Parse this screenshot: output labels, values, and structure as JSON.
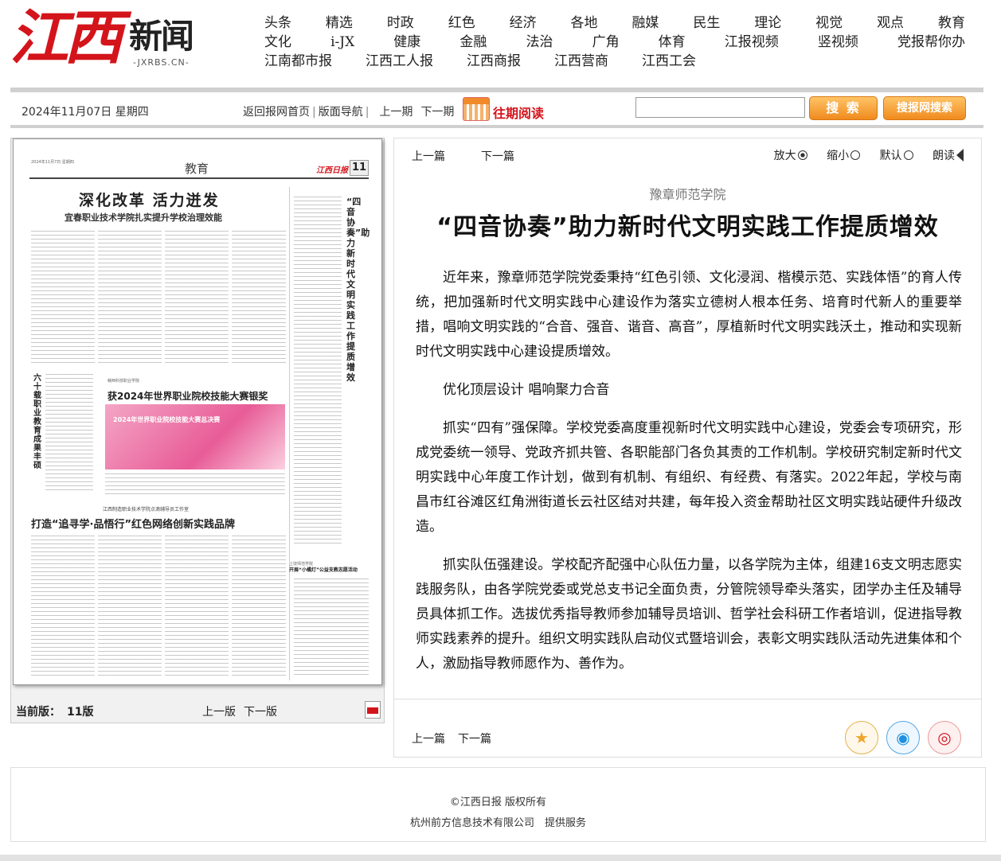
{
  "logo": {
    "calligraphy": "江西",
    "name": "新闻",
    "sub": "-JXRBS.CN-"
  },
  "nav": {
    "row1": [
      "头条",
      "精选",
      "时政",
      "红色",
      "经济",
      "各地",
      "融媒",
      "民生",
      "理论",
      "视觉",
      "观点",
      "教育"
    ],
    "row2": [
      "文化",
      "i-JX",
      "健康",
      "金融",
      "法治",
      "广角",
      "体育",
      "江报视频",
      "竖视频",
      "党报帮你办"
    ],
    "row3": [
      "江南都市报",
      "江西工人报",
      "江西商报",
      "江西营商",
      "江西工会"
    ]
  },
  "toolbar": {
    "date": "2024年11月07日 星期四",
    "home": "返回报网首页",
    "layout_nav": "版面导航",
    "prev_issue": "上一期",
    "next_issue": "下一期",
    "past_reading": "往期阅读",
    "search_value": "",
    "search_btn": "搜 索",
    "site_search_btn": "搜报网搜索"
  },
  "newspaper_page": {
    "date_line": "2024年11月7日 星期四",
    "section": "教育",
    "brand": "江西日报",
    "number": "11",
    "headline1": "深化改革 活力迸发",
    "subhead1": "宜春职业技术学院扎实提升学校治理效能",
    "kicker2": "赣西科技职业学院",
    "headline2": "获2024年世界职业院校技能大赛银奖",
    "photo_caption": "2024年世界职业院校技能大赛总决赛",
    "side_title": "“四音协奏”助力新时代文明实践工作提质增效",
    "side_vertical": "六十载职业教育成果丰硕",
    "subhead3": "江西制造职业技术学院点滴辅导员工作室",
    "headline3": "打造“追寻学·品悟行”红色网络创新实践品牌",
    "kicker4": "上饶师范学院",
    "headline4": "开展“小橘灯”公益支教志愿活动"
  },
  "page_footer": {
    "current_label": "当前版：",
    "current_value": "11版",
    "prev_page": "上一版",
    "next_page": "下一版"
  },
  "article": {
    "prev": "上一篇",
    "next": "下一篇",
    "zoom_in": "放大",
    "zoom_out": "缩小",
    "default": "默认",
    "read_aloud": "朗读",
    "kicker": "豫章师范学院",
    "headline": "“四音协奏”助力新时代文明实践工作提质增效",
    "paragraphs": [
      "近年来，豫章师范学院党委秉持“红色引领、文化浸润、楷模示范、实践体悟”的育人传统，把加强新时代文明实践中心建设作为落实立德树人根本任务、培育时代新人的重要举措，唱响文明实践的“合音、强音、谐音、高音”，厚植新时代文明实践沃土，推动和实现新时代文明实践中心建设提质增效。",
      "优化顶层设计 唱响聚力合音",
      "抓实“四有”强保障。学校党委高度重视新时代文明实践中心建设，党委会专项研究，形成党委统一领导、党政齐抓共管、各职能部门各负其责的工作机制。学校研究制定新时代文明实践中心年度工作计划，做到有机制、有组织、有经费、有落实。2022年起，学校与南昌市红谷滩区红角洲街道长云社区结对共建，每年投入资金帮助社区文明实践站硬件升级改造。",
      "抓实队伍强建设。学校配齐配强中心队伍力量，以各学院为主体，组建16支文明志愿实践服务队，由各学院党委或党总支书记全面负责，分管院领导牵头落实，团学办主任及辅导员具体抓工作。选拔优秀指导教师参加辅导员培训、哲学社会科研工作者培训，促进指导教师实践素养的提升。组织文明实践队启动仪式暨培训会，表彰文明实践队活动先进集体和个人，激励指导教师愿作为、善作为。"
    ],
    "bottom_prev": "上一篇",
    "bottom_next": "下一篇",
    "share_icons": [
      "star-icon",
      "qq-icon",
      "weibo-icon"
    ]
  },
  "footer": {
    "copyright": "©江西日报 版权所有",
    "provider": "杭州前方信息技术有限公司　提供服务"
  },
  "colors": {
    "brand_red": "#d4141b",
    "button_orange": "#f08a1e"
  }
}
